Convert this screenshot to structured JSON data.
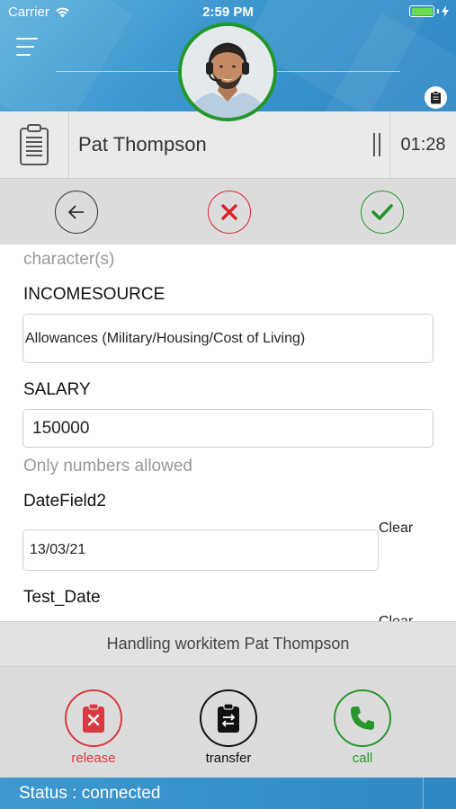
{
  "status_bar": {
    "carrier": "Carrier",
    "time": "2:59 PM"
  },
  "header": {
    "avatar_icon": "agent-avatar-icon",
    "menu_icon": "hamburger-menu-icon",
    "badge_icon": "clipboard-icon"
  },
  "contact": {
    "name": "Pat Thompson",
    "timer": "01:28"
  },
  "form": {
    "top_hint": "character(s)",
    "income_source": {
      "label": "INCOMESOURCE",
      "value": "Allowances (Military/Housing/Cost of Living)"
    },
    "salary": {
      "label": "SALARY",
      "value": "150000",
      "hint": "Only numbers allowed"
    },
    "date_field2": {
      "label": "DateField2",
      "value": "13/03/21",
      "clear": "Clear"
    },
    "test_date": {
      "label": "Test_Date",
      "clear": "Clear"
    }
  },
  "handling": {
    "text": "Handling workitem Pat Thompson"
  },
  "actions": {
    "release": "release",
    "transfer": "transfer",
    "call": "call"
  },
  "connection": {
    "status": "Status : connected"
  },
  "colors": {
    "header_blue": "#3e98cf",
    "accept_green": "#23962c",
    "cancel_red": "#d9232d"
  }
}
